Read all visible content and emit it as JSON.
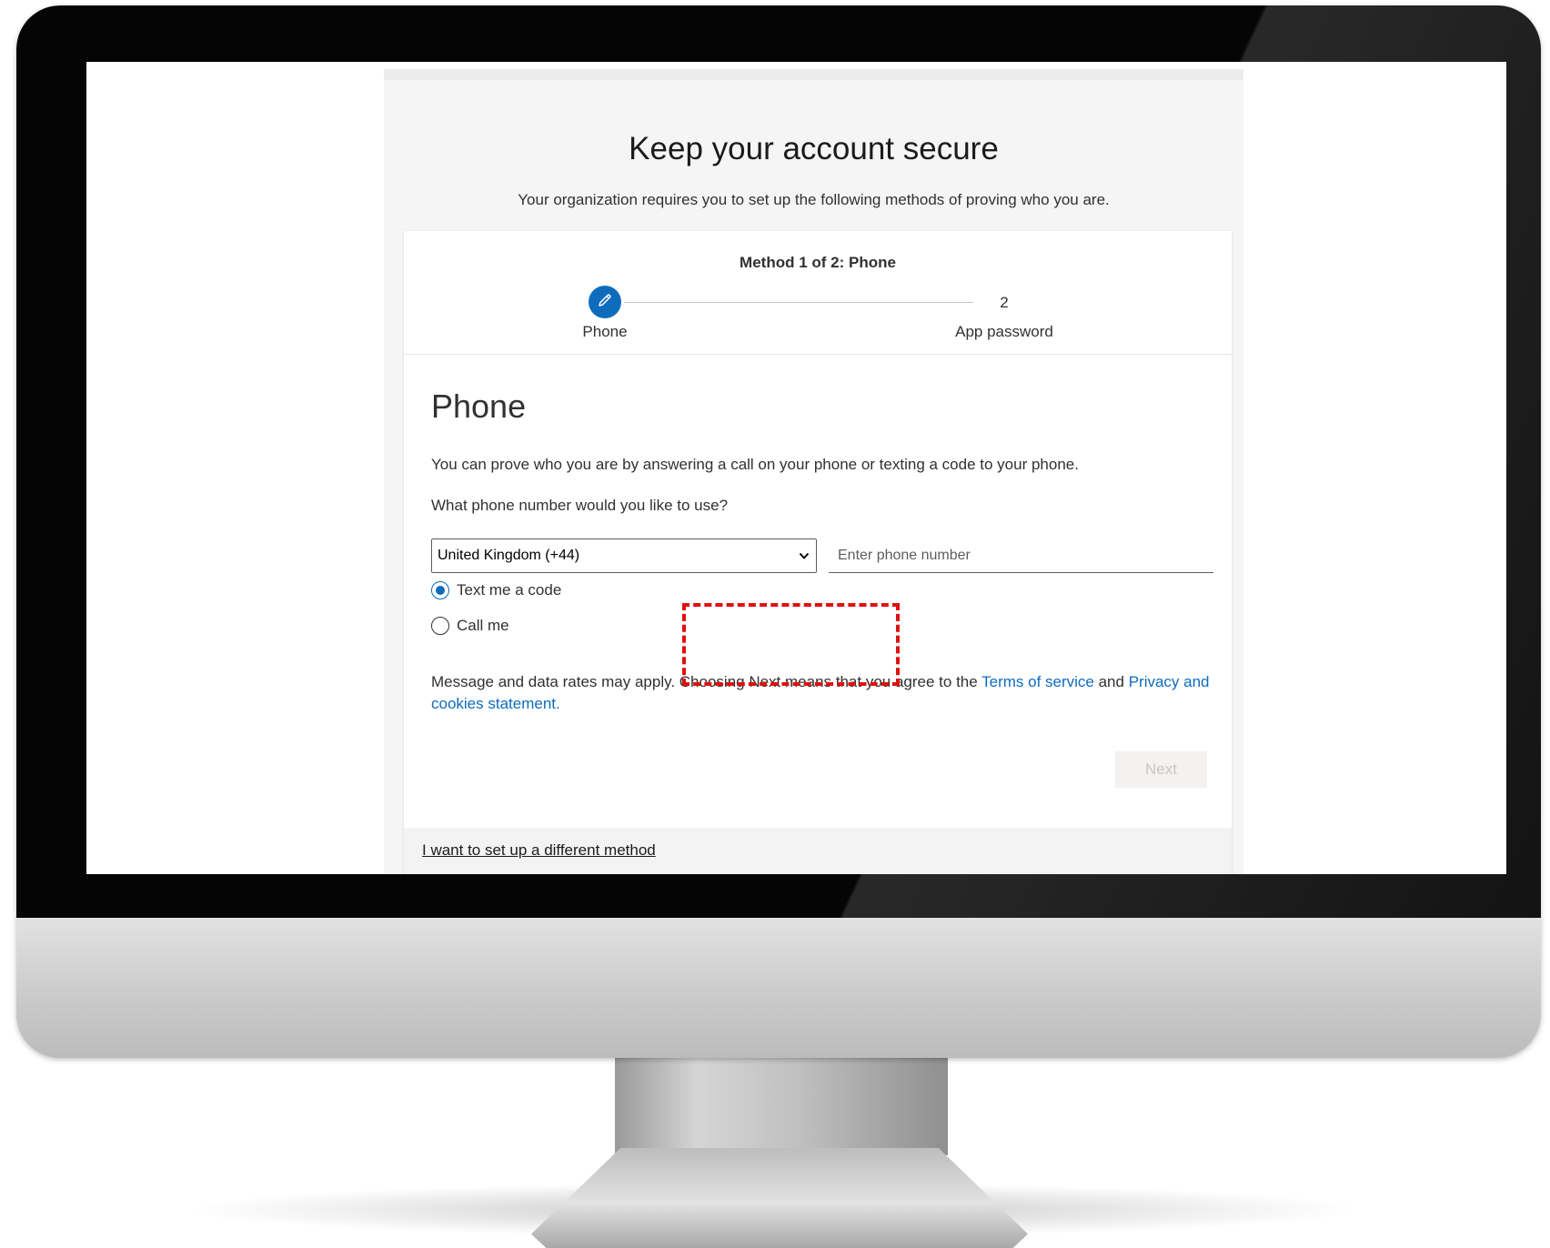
{
  "page": {
    "title": "Keep your account secure",
    "subtitle": "Your organization requires you to set up the following methods of proving who you are."
  },
  "wizard": {
    "method_title": "Method 1 of 2: Phone",
    "steps": [
      {
        "label": "Phone",
        "state": "current",
        "icon": "pencil-icon"
      },
      {
        "number": "2",
        "label": "App password",
        "state": "pending"
      }
    ]
  },
  "phone_section": {
    "title": "Phone",
    "description": "You can prove who you are by answering a call on your phone or texting a code to your phone.",
    "question": "What phone number would you like to use?",
    "country_select": {
      "value": "United Kingdom (+44)"
    },
    "phone_input": {
      "placeholder": "Enter phone number",
      "value": ""
    },
    "options": [
      {
        "label": "Text me a code",
        "selected": true
      },
      {
        "label": "Call me",
        "selected": false
      }
    ],
    "legal": {
      "prefix": "Message and data rates may apply. Choosing Next means that you agree to the ",
      "terms_link": "Terms of service",
      "middle": " and ",
      "privacy_link": "Privacy and cookies statement."
    },
    "next_label": "Next"
  },
  "footer": {
    "different_method_link": "I want to set up a different method"
  },
  "colors": {
    "accent": "#0f6cbd",
    "highlight": "#e01010",
    "panel_bg": "#f5f5f5"
  }
}
